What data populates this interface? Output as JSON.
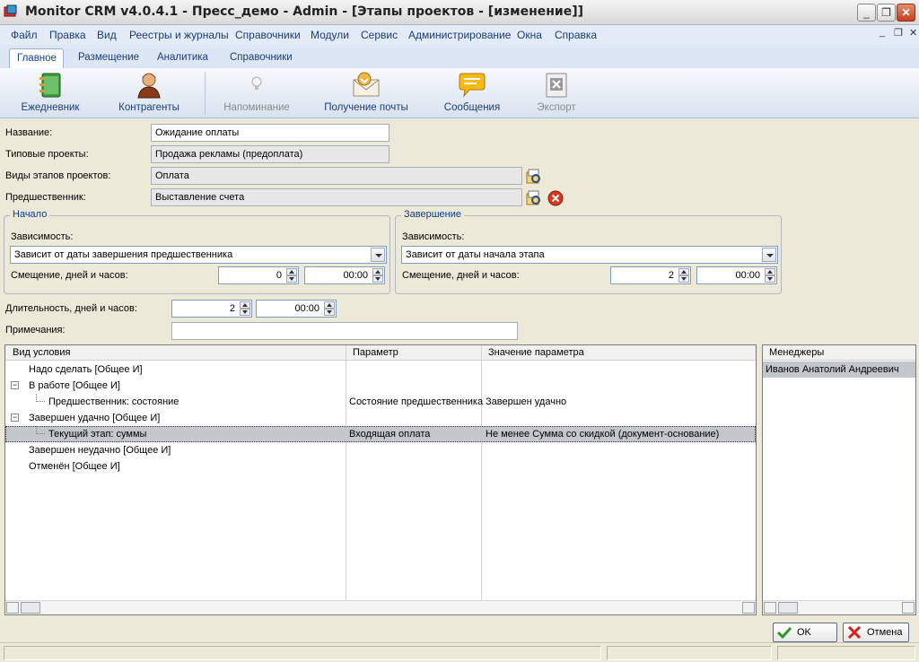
{
  "window": {
    "title": "Monitor CRM v4.0.4.1 - Пресс_демо - Admin - [Этапы проектов - [изменение]]"
  },
  "menu": [
    "Файл",
    "Правка",
    "Вид",
    "Реестры и журналы",
    "Справочники",
    "Модули",
    "Сервис",
    "Администрирование",
    "Окна",
    "Справка"
  ],
  "ribbon_tabs": [
    "Главное",
    "Размещение",
    "Аналитика",
    "Справочники"
  ],
  "ribbon_buttons": [
    {
      "label": "Ежедневник",
      "icon": "notebook-icon",
      "enabled": true
    },
    {
      "label": "Контрагенты",
      "icon": "person-icon",
      "enabled": true
    },
    {
      "label": "Напоминание",
      "icon": "bulb-icon",
      "enabled": false
    },
    {
      "label": "Получение почты",
      "icon": "mail-receive-icon",
      "enabled": true
    },
    {
      "label": "Сообщения",
      "icon": "message-icon",
      "enabled": true
    },
    {
      "label": "Экспорт",
      "icon": "export-icon",
      "enabled": false
    }
  ],
  "form": {
    "name_label": "Название:",
    "name_value": "Ожидание оплаты",
    "typical_label": "Типовые проекты:",
    "typical_value": "Продажа рекламы (предоплата)",
    "stage_type_label": "Виды этапов проектов:",
    "stage_type_value": "Оплата",
    "predecessor_label": "Предшественник:",
    "predecessor_value": "Выставление счета",
    "start": {
      "title": "Начало",
      "dependency_label": "Зависимость:",
      "dependency_value": "Зависит от даты завершения предшественника",
      "offset_label": "Смещение, дней и часов:",
      "offset_days": "0",
      "offset_time": "00:00"
    },
    "end": {
      "title": "Завершение",
      "dependency_label": "Зависимость:",
      "dependency_value": "Зависит от даты начала этапа",
      "offset_label": "Смещение, дней и часов:",
      "offset_days": "2",
      "offset_time": "00:00"
    },
    "duration_label": "Длительность, дней и часов:",
    "duration_days": "2",
    "duration_time": "00:00",
    "notes_label": "Примечания:",
    "notes_value": ""
  },
  "conditions": {
    "columns": [
      "Вид условия",
      "Параметр",
      "Значение параметра"
    ],
    "rows": [
      {
        "condition": "Надо сделать [Общее И]",
        "param": "",
        "value": ""
      },
      {
        "condition": "В работе [Общее И]",
        "param": "",
        "value": ""
      },
      {
        "condition": "Предшественник: состояние",
        "param": "Состояние предшественника",
        "value": "Завершен удачно"
      },
      {
        "condition": "Завершен удачно [Общее И]",
        "param": "",
        "value": ""
      },
      {
        "condition": "Текущий этап: суммы",
        "param": "Входящая оплата",
        "value": "Не менее Сумма со скидкой (документ-основание)"
      },
      {
        "condition": "Завершен неудачно [Общее И]",
        "param": "",
        "value": ""
      },
      {
        "condition": "Отменён [Общее И]",
        "param": "",
        "value": ""
      }
    ]
  },
  "managers": {
    "column": "Менеджеры",
    "items": [
      "Иванов Анатолий Андреевич"
    ]
  },
  "buttons": {
    "ok": "OK",
    "cancel": "Отмена"
  }
}
